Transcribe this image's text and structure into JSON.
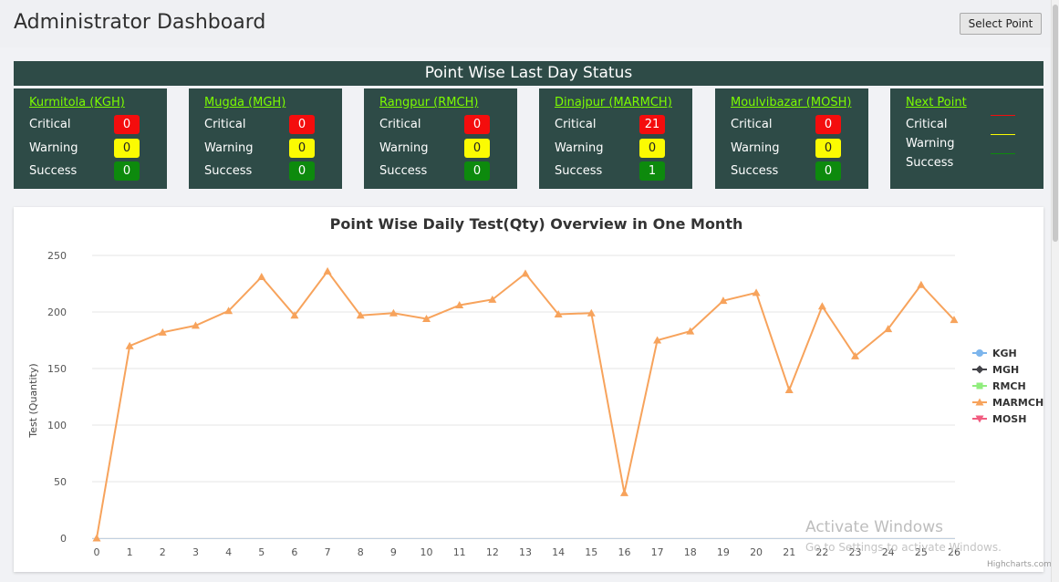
{
  "header": {
    "title": "Administrator Dashboard",
    "select_point_label": "Select Point"
  },
  "status": {
    "title": "Point Wise Last Day Status",
    "labels": {
      "critical": "Critical",
      "warning": "Warning",
      "success": "Success"
    },
    "cards": [
      {
        "name": "Kurmitola (KGH)",
        "critical": "0",
        "warning": "0",
        "success": "0"
      },
      {
        "name": "Mugda (MGH)",
        "critical": "0",
        "warning": "0",
        "success": "0"
      },
      {
        "name": "Rangpur (RMCH)",
        "critical": "0",
        "warning": "0",
        "success": "0"
      },
      {
        "name": "Dinajpur (MARMCH)",
        "critical": "21",
        "warning": "0",
        "success": "1"
      },
      {
        "name": "Moulvibazar (MOSH)",
        "critical": "0",
        "warning": "0",
        "success": "0"
      }
    ],
    "next_card": {
      "name": "Next Point"
    }
  },
  "colors": {
    "critical": "#f40d0d",
    "warning": "#fbfb02",
    "success": "#0d8a0d",
    "panel": "#2e4b47",
    "link": "#7cfc00"
  },
  "chart_data": {
    "type": "line",
    "title": "Point Wise Daily Test(Qty) Overview in One Month",
    "xlabel": "",
    "ylabel": "Test (Quantity)",
    "ylim": [
      0,
      250
    ],
    "yticks": [
      0,
      50,
      100,
      150,
      200,
      250
    ],
    "x": [
      0,
      1,
      2,
      3,
      4,
      5,
      6,
      7,
      8,
      9,
      10,
      11,
      12,
      13,
      14,
      15,
      16,
      17,
      18,
      19,
      20,
      21,
      22,
      23,
      24,
      25,
      26
    ],
    "grid": true,
    "legend_position": "right",
    "series": [
      {
        "name": "KGH",
        "color": "#7cb5ec",
        "marker": "circle",
        "values": []
      },
      {
        "name": "MGH",
        "color": "#434348",
        "marker": "diamond",
        "values": []
      },
      {
        "name": "RMCH",
        "color": "#90ed7d",
        "marker": "square",
        "values": []
      },
      {
        "name": "MARMCH",
        "color": "#f7a35c",
        "marker": "triangle",
        "values": [
          0,
          170,
          182,
          188,
          201,
          231,
          197,
          236,
          197,
          199,
          194,
          206,
          211,
          234,
          198,
          199,
          40,
          175,
          183,
          210,
          217,
          131,
          205,
          161,
          185,
          224,
          193
        ]
      },
      {
        "name": "MOSH",
        "color": "#f15c80",
        "marker": "triangle-down",
        "values": []
      }
    ]
  },
  "watermark": {
    "line1": "Activate Windows",
    "line2": "Go to Settings to activate Windows."
  },
  "credits": "Highcharts.com"
}
